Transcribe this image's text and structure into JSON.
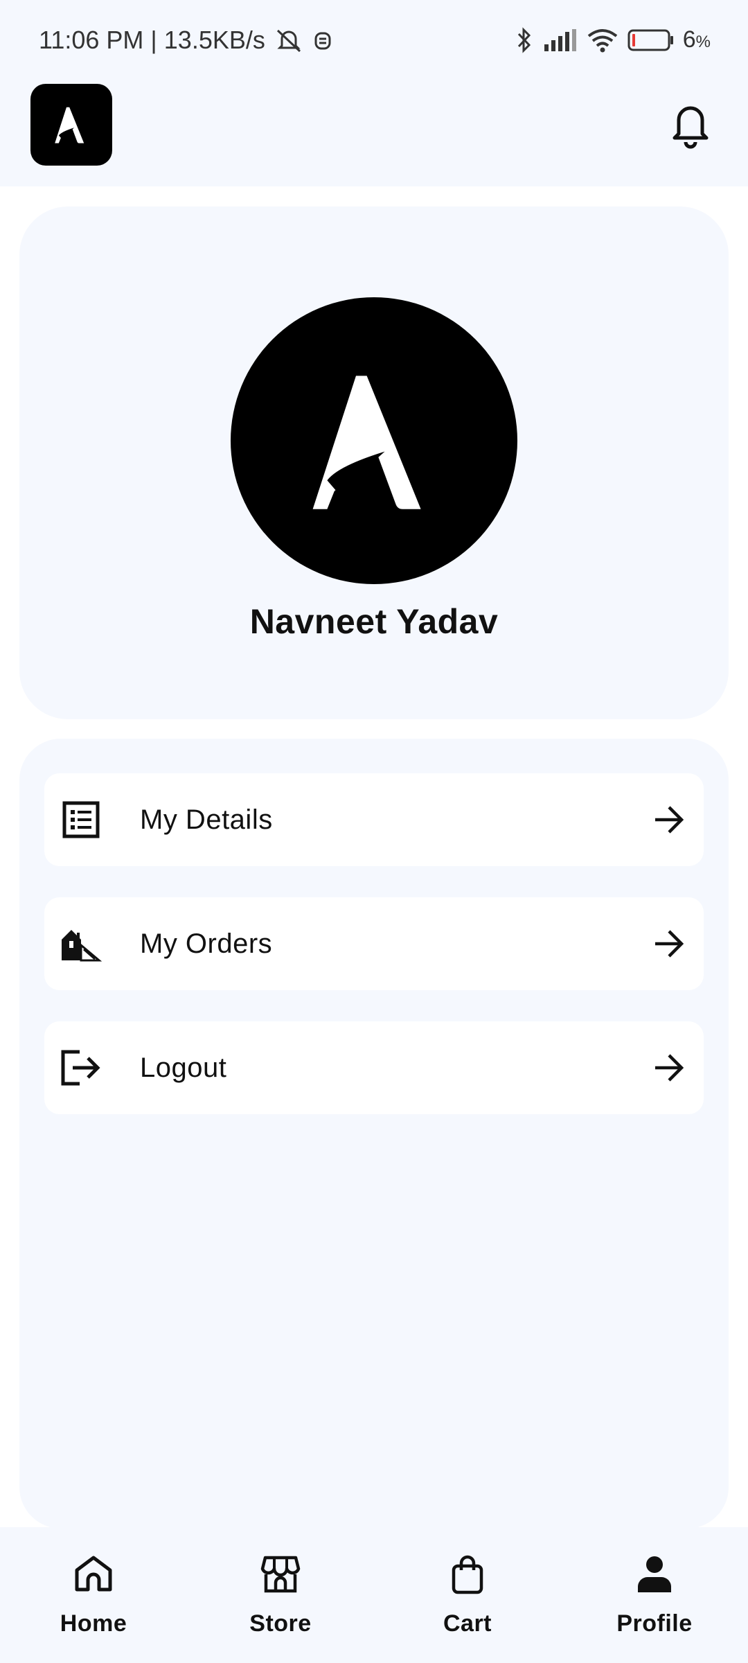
{
  "status_bar": {
    "time_speed": "11:06 PM | 13.5KB/s",
    "battery_percent": "6",
    "battery_unit": "%",
    "icons": [
      "mute-bell-icon",
      "android-face-icon",
      "bluetooth-icon",
      "signal-icon",
      "wifi-icon",
      "battery-icon"
    ]
  },
  "header": {
    "logo_icon": "brand-logo-icon",
    "notification_icon": "bell-icon"
  },
  "profile": {
    "avatar_icon": "brand-logo-icon",
    "name": "Navneet Yadav"
  },
  "menu": {
    "items": [
      {
        "label": "My Details",
        "icon": "list-details-icon"
      },
      {
        "label": "My Orders",
        "icon": "shop-orders-icon"
      },
      {
        "label": "Logout",
        "icon": "logout-icon"
      }
    ],
    "arrow_icon": "arrow-right-icon"
  },
  "bottom_nav": {
    "items": [
      {
        "label": "Home",
        "icon": "home-icon",
        "active": false
      },
      {
        "label": "Store",
        "icon": "store-icon",
        "active": false
      },
      {
        "label": "Cart",
        "icon": "shopping-bag-icon",
        "active": false
      },
      {
        "label": "Profile",
        "icon": "person-icon",
        "active": true
      }
    ]
  },
  "colors": {
    "background": "#f5f8fe",
    "card": "#ffffff",
    "text": "#111111",
    "battery_low": "#e53935"
  }
}
